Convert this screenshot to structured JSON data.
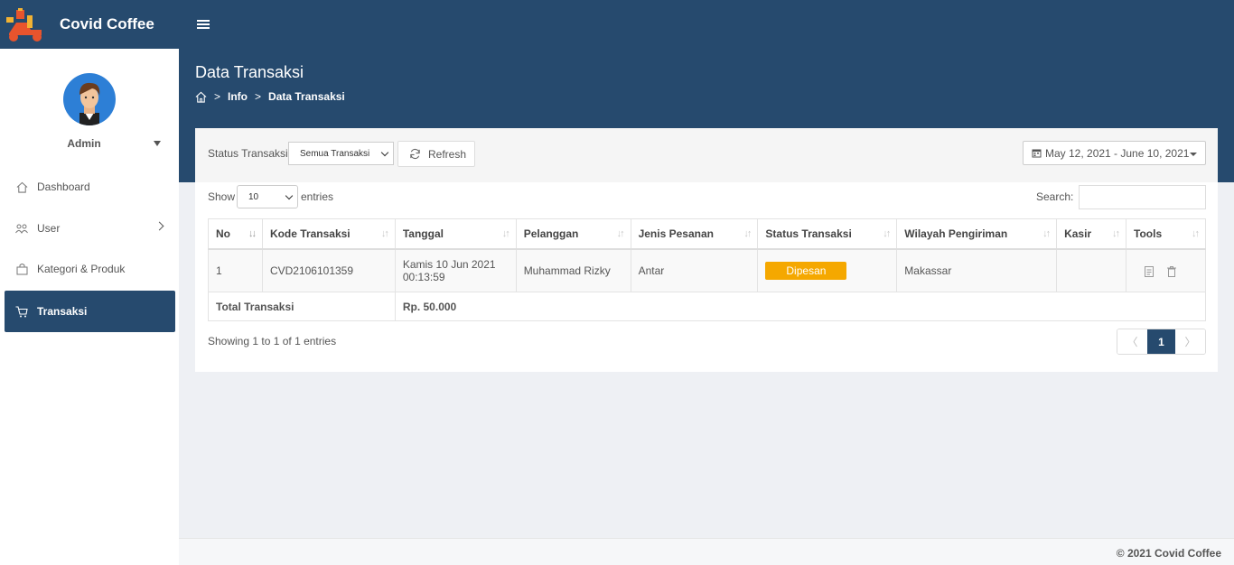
{
  "app": {
    "title": "Covid Coffee"
  },
  "user": {
    "name": "Admin"
  },
  "sidebar": {
    "items": [
      {
        "label": "Dashboard",
        "icon": "home-icon"
      },
      {
        "label": "User",
        "icon": "users-icon"
      },
      {
        "label": "Kategori & Produk",
        "icon": "bag-icon"
      },
      {
        "label": "Transaksi",
        "icon": "cart-icon",
        "active": true
      }
    ]
  },
  "header": {
    "title": "Data Transaksi",
    "breadcrumb": [
      "Info",
      "Data Transaksi"
    ]
  },
  "filters": {
    "status_label": "Status Transaksi",
    "status_value": "Semua Transaksi",
    "refresh_label": "Refresh",
    "date_range": "May 12, 2021 - June 10, 2021"
  },
  "table_controls": {
    "show_label": "Show",
    "entries_value": "10",
    "entries_label": "entries",
    "search_label": "Search:"
  },
  "table": {
    "columns": [
      "No",
      "Kode Transaksi",
      "Tanggal",
      "Pelanggan",
      "Jenis Pesanan",
      "Status Transaksi",
      "Wilayah Pengiriman",
      "Kasir",
      "Tools"
    ],
    "rows": [
      {
        "no": "1",
        "kode": "CVD2106101359",
        "tanggal_line1": "Kamis 10 Jun 2021",
        "tanggal_line2": "00:13:59",
        "pelanggan": "Muhammad Rizky",
        "jenis": "Antar",
        "status": "Dipesan",
        "wilayah": "Makassar",
        "kasir": ""
      }
    ],
    "total_label": "Total Transaksi",
    "total_value": "Rp. 50.000"
  },
  "pagination": {
    "info": "Showing 1 to 1 of 1 entries",
    "prev": "〈",
    "current": "1",
    "next": "〉"
  },
  "footer": {
    "text": "© 2021 Covid Coffee"
  },
  "colors": {
    "primary": "#264a6e",
    "badge": "#f5a800",
    "background": "#eef0f4"
  }
}
